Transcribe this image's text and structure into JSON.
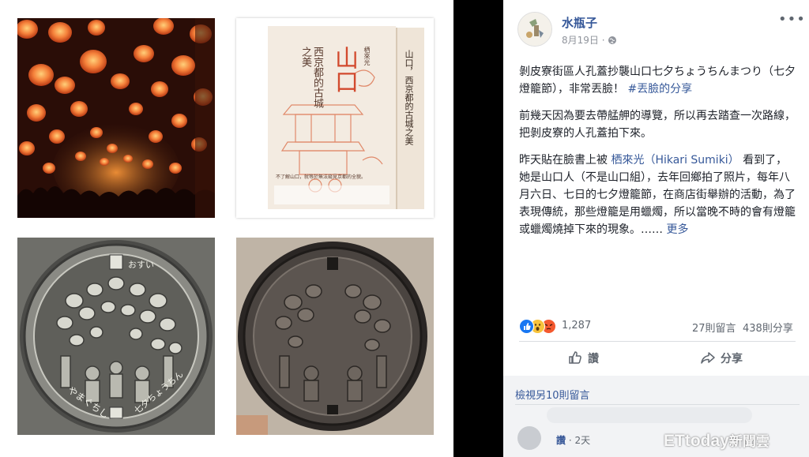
{
  "post": {
    "author": "水瓶子",
    "date": "8月19日",
    "privacy_sep": "·",
    "paragraphs": {
      "p1_text": "剝皮寮街區人孔蓋抄襲山口七夕ちょうちんまつり（七夕燈籠節），非常丟臉！",
      "p1_tag": "#丟臉的分享",
      "p2": "前幾天因為要去帶艋舺的導覽，所以再去踏查一次路線，把剝皮寮的人孔蓋拍下來。",
      "p3_a": "昨天貼在臉書上被",
      "p3_link": "栖來光（Hikari Sumiki）",
      "p3_b": "看到了，她是山口人（不是山口組），去年回鄉拍了照片，每年八月六日、七日的七夕燈籠節，在商店街舉辦的活動，為了表現傳統，那些燈籠是用蠟燭，所以當晚不時的會有燈籠或蠟燭燒掉下來的現象。……",
      "more": "更多"
    }
  },
  "photos": {
    "book_title": "山口",
    "book_subtitle": "西京都的古城之美",
    "book_author": "栖來光",
    "book_spine": "山口，西京都的古城之美",
    "book_tagline": "不了解山口，就等於無法窺見京都的全貌。",
    "manhole_left_top": "おすい",
    "manhole_left_bottom_left": "やまぐちし",
    "manhole_left_bottom_right": "七夕ちょうちん"
  },
  "reactions": {
    "count": "1,287",
    "comments": "27則留言",
    "shares": "438則分享"
  },
  "actions": {
    "like": "讚",
    "share": "分享"
  },
  "comments": {
    "view_more": "檢視另10則留言",
    "like_label": "讚",
    "sep": "·",
    "time": "2天"
  },
  "watermark": {
    "brand": "ETtoday",
    "sub": "新聞雲"
  },
  "colors": {
    "link": "#365899",
    "lantern": "#f6883a",
    "like_blue": "#1877f2",
    "angry": "#f4592f",
    "wow": "#f7c33c"
  }
}
